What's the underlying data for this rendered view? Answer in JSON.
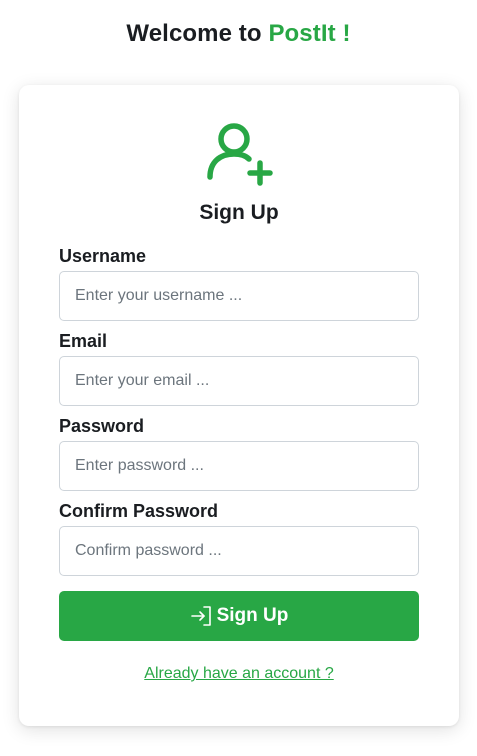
{
  "header": {
    "prefix": "Welcome to ",
    "brand": "PostIt !"
  },
  "card": {
    "icon": "person-add-icon",
    "title": "Sign Up"
  },
  "form": {
    "username": {
      "label": "Username",
      "placeholder": "Enter your username ...",
      "value": ""
    },
    "email": {
      "label": "Email",
      "placeholder": "Enter your email ...",
      "value": ""
    },
    "password": {
      "label": "Password",
      "placeholder": "Enter password ...",
      "value": ""
    },
    "confirm_password": {
      "label": "Confirm Password",
      "placeholder": "Confirm password ...",
      "value": ""
    },
    "submit": {
      "label": "Sign Up",
      "icon": "sign-in-icon"
    }
  },
  "links": {
    "login": "Already have an account ?"
  },
  "colors": {
    "accent": "#28a745",
    "text": "#1a1d21",
    "border": "#ced4da",
    "placeholder": "#6c757d"
  }
}
